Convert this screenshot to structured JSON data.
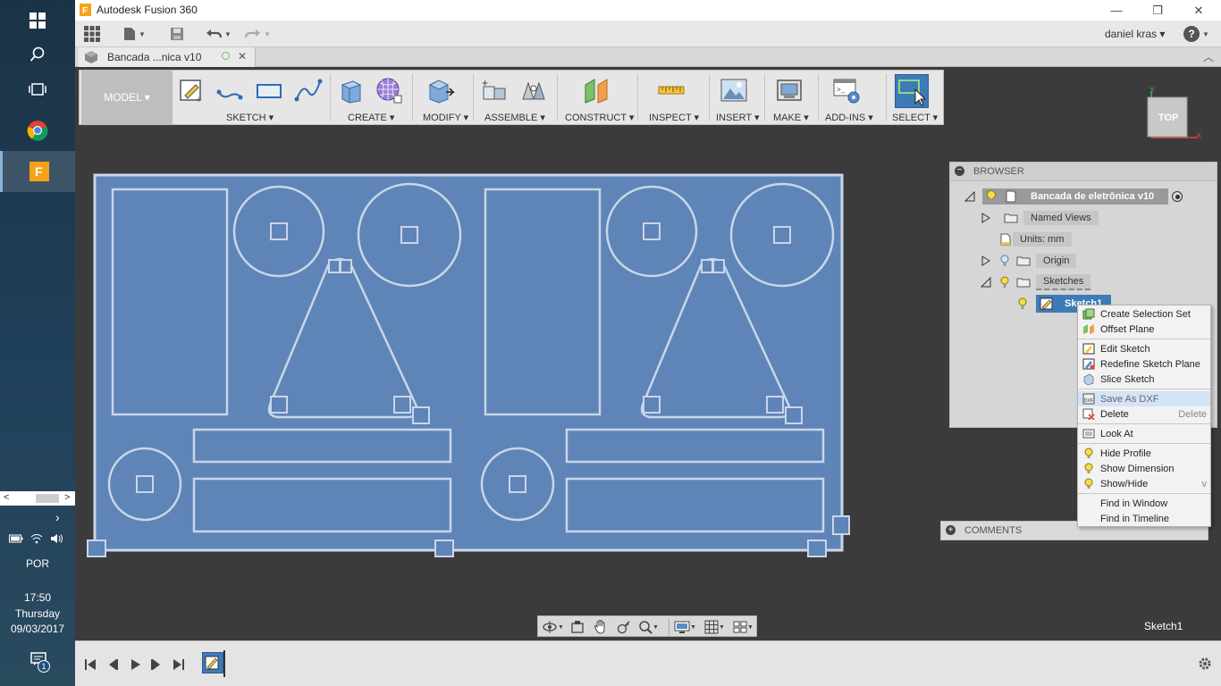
{
  "window": {
    "title": "Autodesk Fusion 360",
    "minimize": "—",
    "restore": "❐",
    "close": "✕"
  },
  "taskbar": {
    "language": "POR",
    "time": "17:50",
    "day": "Thursday",
    "date": "09/03/2017",
    "notification_count": "1"
  },
  "qat": {
    "user": "daniel kras ▾",
    "help": "?"
  },
  "document": {
    "tab_title": "Bancada ...nica v10",
    "close": "✕"
  },
  "toolbar": {
    "workspace": "MODEL ▾",
    "groups": [
      "SKETCH ▾",
      "CREATE ▾",
      "MODIFY ▾",
      "ASSEMBLE ▾",
      "CONSTRUCT ▾",
      "INSPECT ▾",
      "INSERT ▾",
      "MAKE ▾",
      "ADD-INS ▾",
      "SELECT ▾"
    ]
  },
  "browser": {
    "header": "BROWSER",
    "root": "Bancada de eletrônica v10",
    "items": [
      "Named Views",
      "Units: mm",
      "Origin",
      "Sketches",
      "Sketch1"
    ]
  },
  "context_menu": {
    "items": [
      {
        "label": "Create Selection Set",
        "shortcut": ""
      },
      {
        "label": "Offset Plane",
        "shortcut": ""
      },
      {
        "label": "Edit Sketch",
        "shortcut": ""
      },
      {
        "label": "Redefine Sketch Plane",
        "shortcut": ""
      },
      {
        "label": "Slice Sketch",
        "shortcut": ""
      },
      {
        "label": "Save As DXF",
        "shortcut": ""
      },
      {
        "label": "Delete",
        "shortcut": "Delete"
      },
      {
        "label": "Look At",
        "shortcut": ""
      },
      {
        "label": "Hide Profile",
        "shortcut": ""
      },
      {
        "label": "Show Dimension",
        "shortcut": ""
      },
      {
        "label": "Show/Hide",
        "shortcut": "v"
      },
      {
        "label": "Find in Window",
        "shortcut": ""
      },
      {
        "label": "Find in Timeline",
        "shortcut": ""
      }
    ]
  },
  "comments": {
    "label": "COMMENTS"
  },
  "viewcube": {
    "face": "TOP",
    "axis_x": "X",
    "axis_y": "Y"
  },
  "status": {
    "active_sketch": "Sketch1"
  },
  "colors": {
    "sketch_fill": "#5f84b8",
    "sketch_line": "#c9d6e8",
    "highlight": "#d4e4f7"
  }
}
